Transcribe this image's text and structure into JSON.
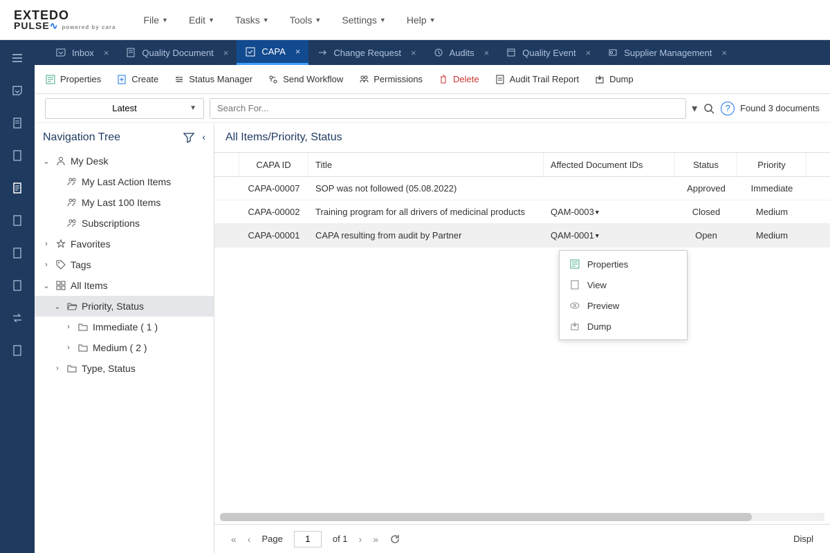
{
  "brand": {
    "line1": "EXTEDO",
    "line2": "PULSE",
    "tagline": "powered by cara"
  },
  "menubar": [
    "File",
    "Edit",
    "Tasks",
    "Tools",
    "Settings",
    "Help"
  ],
  "tabs": [
    {
      "label": "Inbox",
      "icon": "inbox"
    },
    {
      "label": "Quality Document",
      "icon": "qdoc"
    },
    {
      "label": "CAPA",
      "icon": "capa",
      "active": true
    },
    {
      "label": "Change Request",
      "icon": "cr"
    },
    {
      "label": "Audits",
      "icon": "audit"
    },
    {
      "label": "Quality Event",
      "icon": "qe"
    },
    {
      "label": "Supplier Management",
      "icon": "sup"
    }
  ],
  "toolbar": [
    {
      "label": "Properties",
      "icon": "props",
      "color": "#4a8"
    },
    {
      "label": "Create",
      "icon": "create",
      "color": "#1A73E8"
    },
    {
      "label": "Status Manager",
      "icon": "status",
      "color": "#333"
    },
    {
      "label": "Send Workflow",
      "icon": "workflow",
      "color": "#333"
    },
    {
      "label": "Permissions",
      "icon": "perm",
      "color": "#333"
    },
    {
      "label": "Delete",
      "icon": "delete",
      "color": "#c33",
      "danger": true
    },
    {
      "label": "Audit Trail Report",
      "icon": "report",
      "color": "#333"
    },
    {
      "label": "Dump",
      "icon": "dump",
      "color": "#333"
    }
  ],
  "searchrow": {
    "dropdown": "Latest",
    "placeholder": "Search For...",
    "found": "Found 3 documents"
  },
  "sidebar": {
    "title": "Navigation Tree",
    "tree": [
      {
        "lvl": 0,
        "chev": "down",
        "icon": "user",
        "label": "My Desk"
      },
      {
        "lvl": 1,
        "chev": "",
        "icon": "users",
        "label": "My Last Action Items"
      },
      {
        "lvl": 1,
        "chev": "",
        "icon": "users",
        "label": "My Last 100 Items"
      },
      {
        "lvl": 1,
        "chev": "",
        "icon": "users",
        "label": "Subscriptions"
      },
      {
        "lvl": 0,
        "chev": "right",
        "icon": "star",
        "label": "Favorites"
      },
      {
        "lvl": 0,
        "chev": "right",
        "icon": "tag",
        "label": "Tags"
      },
      {
        "lvl": 0,
        "chev": "down",
        "icon": "grid",
        "label": "All Items"
      },
      {
        "lvl": 1,
        "chev": "down",
        "icon": "folder-open",
        "label": "Priority, Status",
        "sel": true
      },
      {
        "lvl": 2,
        "chev": "right",
        "icon": "folder",
        "label": "Immediate ( 1 )"
      },
      {
        "lvl": 2,
        "chev": "right",
        "icon": "folder",
        "label": "Medium ( 2 )"
      },
      {
        "lvl": 1,
        "chev": "right",
        "icon": "folder",
        "label": "Type, Status"
      }
    ]
  },
  "grid": {
    "title": "All Items/Priority, Status",
    "cols": [
      "",
      "CAPA ID",
      "Title",
      "Affected Document IDs",
      "Status",
      "Priority"
    ],
    "rows": [
      {
        "id": "CAPA-00007",
        "title": "SOP was not followed (05.08.2022)",
        "aff": "",
        "status": "Approved",
        "prio": "Immediate"
      },
      {
        "id": "CAPA-00002",
        "title": "Training program for all drivers of medicinal products",
        "aff": "QAM-0003",
        "status": "Closed",
        "prio": "Medium"
      },
      {
        "id": "CAPA-00001",
        "title": "CAPA resulting from audit by Partner",
        "aff": "QAM-0001",
        "status": "Open",
        "prio": "Medium",
        "alt": true
      }
    ]
  },
  "context": [
    {
      "label": "Properties",
      "icon": "props"
    },
    {
      "label": "View",
      "icon": "view"
    },
    {
      "label": "Preview",
      "icon": "preview"
    },
    {
      "label": "Dump",
      "icon": "dump"
    }
  ],
  "pager": {
    "page_label": "Page",
    "page": "1",
    "of": "of 1",
    "disp": "Displ"
  }
}
